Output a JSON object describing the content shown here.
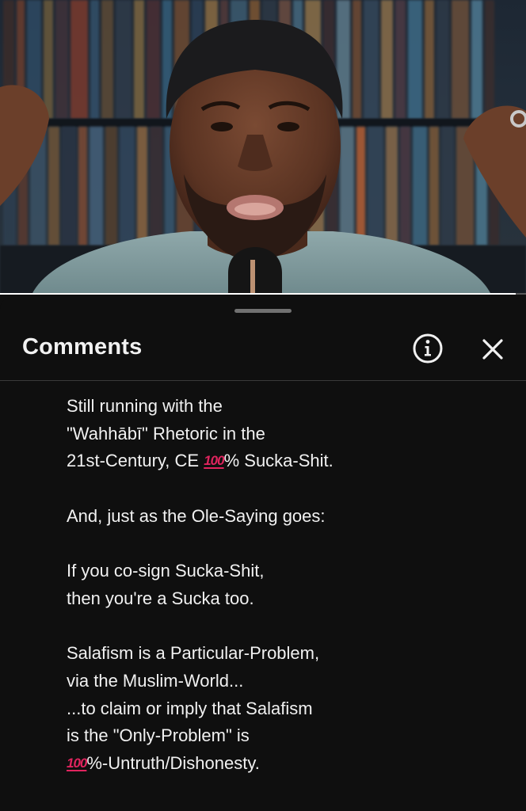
{
  "video": {
    "progress_fraction": 0.98
  },
  "comments_panel": {
    "title": "Comments",
    "info_icon": "info-circle-icon",
    "close_icon": "close-icon",
    "comment": {
      "paragraphs": [
        [
          {
            "text": "Still running with the"
          },
          {
            "text": "\"Wahhābī\" Rhetoric in the"
          },
          {
            "before": "21st-Century, CE ",
            "emoji": "100",
            "after": "% Sucka-Shit."
          }
        ],
        [
          {
            "text": "And, just as the Ole-Saying goes:"
          }
        ],
        [
          {
            "text": "If you co-sign Sucka-Shit,"
          },
          {
            "text": "then you're a Sucka too."
          }
        ],
        [
          {
            "text": "Salafism is a Particular-Problem,"
          },
          {
            "text": "via the Muslim-World..."
          },
          {
            "text": "...to claim or imply that Salafism"
          },
          {
            "text": "is the \"Only-Problem\" is"
          },
          {
            "before": "",
            "emoji": "100",
            "after": "%-Untruth/Dishonesty."
          }
        ]
      ]
    }
  }
}
